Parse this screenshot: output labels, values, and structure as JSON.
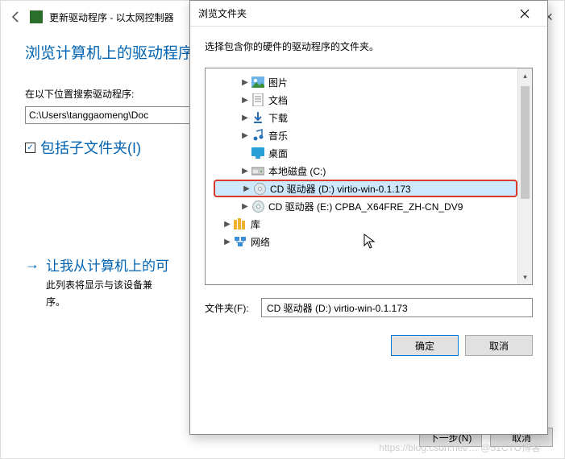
{
  "bg": {
    "window_title": "更新驱动程序 - 以太网控制器",
    "heading": "浏览计算机上的驱动程序",
    "search_label": "在以下位置搜索驱动程序:",
    "path_value": "C:\\Users\\tanggaomeng\\Doc",
    "include_sub": "包括子文件夹(I)",
    "link_title": "让我从计算机上的可",
    "link_desc1": "此列表将显示与该设备兼",
    "link_desc2": "序。",
    "btn_next": "下一步(N)",
    "btn_cancel": "取消"
  },
  "dlg": {
    "title": "浏览文件夹",
    "instruction": "选择包含你的硬件的驱动程序的文件夹。",
    "folder_label": "文件夹(F):",
    "folder_value": "CD 驱动器 (D:) virtio-win-0.1.173",
    "btn_ok": "确定",
    "btn_cancel": "取消"
  },
  "tree": [
    {
      "expand": "right",
      "icon": "pictures",
      "label": "图片",
      "indent": 1
    },
    {
      "expand": "right",
      "icon": "documents",
      "label": "文档",
      "indent": 1
    },
    {
      "expand": "right",
      "icon": "downloads",
      "label": "下载",
      "indent": 1
    },
    {
      "expand": "right",
      "icon": "music",
      "label": "音乐",
      "indent": 1
    },
    {
      "expand": "none",
      "icon": "desktop",
      "label": "桌面",
      "indent": 1
    },
    {
      "expand": "right",
      "icon": "disk",
      "label": "本地磁盘 (C:)",
      "indent": 1
    },
    {
      "expand": "right",
      "icon": "disc",
      "label": "CD 驱动器 (D:) virtio-win-0.1.173",
      "indent": 1,
      "selected": true
    },
    {
      "expand": "right",
      "icon": "disc",
      "label": "CD 驱动器 (E:) CPBA_X64FRE_ZH-CN_DV9",
      "indent": 1
    },
    {
      "expand": "right",
      "icon": "library",
      "label": "库",
      "indent": 0
    },
    {
      "expand": "right",
      "icon": "network",
      "label": "网络",
      "indent": 0
    }
  ],
  "watermark": "https://blog.csdn.net/… @51CTO博客"
}
